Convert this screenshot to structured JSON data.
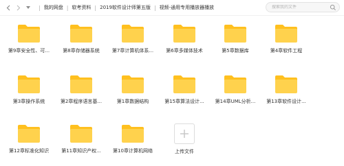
{
  "toolbar": {
    "back_icon": "chevron-left-icon",
    "forward_icon": "chevron-right-icon",
    "dropdown_icon": "caret-down-icon"
  },
  "breadcrumb": {
    "items": [
      "我的网盘",
      "软考资料",
      "2019软件设计师第五版",
      "视频-通用专用播放器播放"
    ],
    "separator": "|"
  },
  "search": {
    "placeholder": "搜索我的文件",
    "icon": "search-icon"
  },
  "colors": {
    "folder": "#ffd24d",
    "folder_tab": "#ffc01f",
    "text": "#333333"
  },
  "folders": [
    {
      "label": "第9章安全性、可..."
    },
    {
      "label": "第8章存储器系统"
    },
    {
      "label": "第7章计算机体系..."
    },
    {
      "label": "第6章多媒体技术"
    },
    {
      "label": "第5章数据库"
    },
    {
      "label": "第4章软件工程"
    },
    {
      "label": "第3章操作系统"
    },
    {
      "label": "第2章程序语言基..."
    },
    {
      "label": "第1章数据结构"
    },
    {
      "label": "第15章算法设计..."
    },
    {
      "label": "第14章UML分析..."
    },
    {
      "label": "第13章软件设计..."
    },
    {
      "label": "第12章标准化知识"
    },
    {
      "label": "第11章知识产权..."
    },
    {
      "label": "第10章计算机网络"
    }
  ],
  "upload": {
    "label": "上传文件",
    "icon": "plus-icon"
  }
}
